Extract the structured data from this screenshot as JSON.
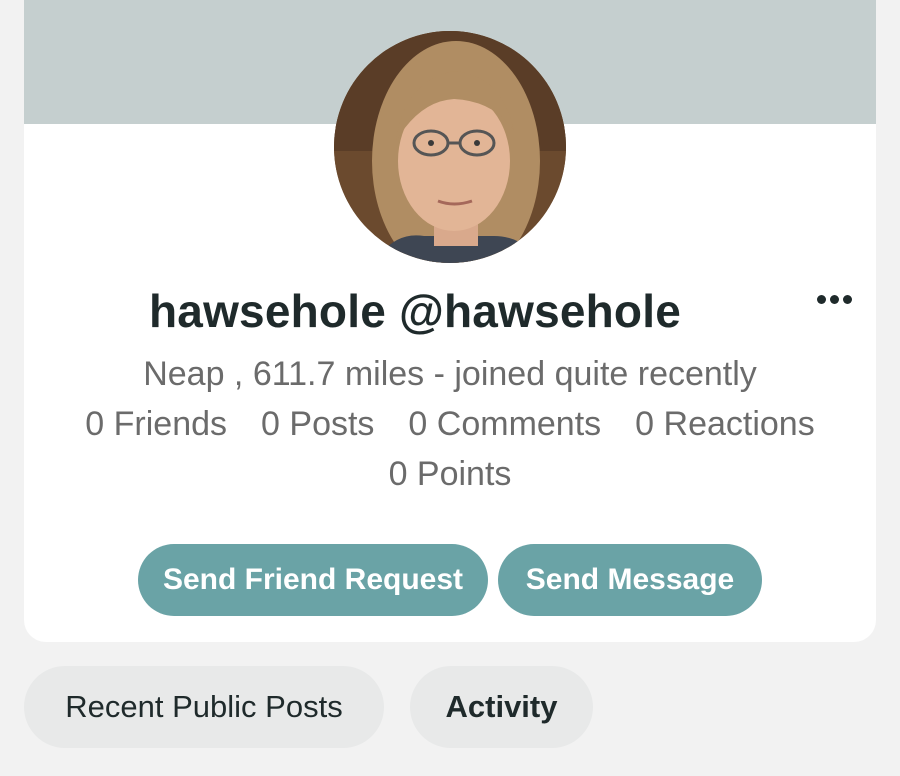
{
  "profile": {
    "display_name": "hawsehole @hawsehole",
    "location_line": "Neap , 611.7 miles - joined quite recently",
    "stats": {
      "friends": "0 Friends",
      "posts": "0 Posts",
      "comments": "0 Comments",
      "reactions": "0 Reactions",
      "points": "0 Points"
    },
    "more_icon": "more-horizontal-icon"
  },
  "actions": {
    "friend_request_label": "Send Friend Request",
    "message_label": "Send Message"
  },
  "tabs": [
    {
      "label": "Recent Public Posts",
      "active": false
    },
    {
      "label": "Activity",
      "active": true
    }
  ],
  "colors": {
    "cover": "#c5cfcf",
    "accent_button": "#6aa3a6",
    "text_dark": "#1f2a2b",
    "text_muted": "#6b6b6b",
    "tab_bg": "#e8e9e9"
  }
}
